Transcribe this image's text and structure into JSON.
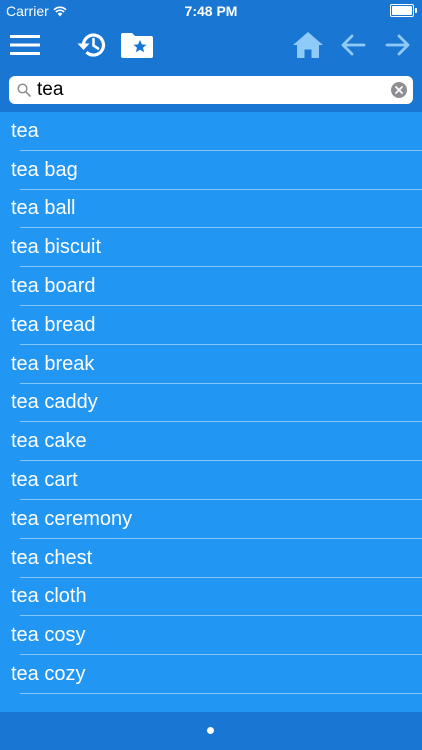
{
  "status_bar": {
    "carrier": "Carrier",
    "time": "7:48 PM"
  },
  "toolbar": {
    "icons": [
      "menu-icon",
      "history-icon",
      "favorites-folder-icon",
      "home-icon",
      "back-arrow-icon",
      "forward-arrow-icon"
    ]
  },
  "search": {
    "value": "tea"
  },
  "results": [
    "tea",
    "tea bag",
    "tea ball",
    "tea biscuit",
    "tea board",
    "tea bread",
    "tea break",
    "tea caddy",
    "tea cake",
    "tea cart",
    "tea ceremony",
    "tea chest",
    "tea cloth",
    "tea cosy",
    "tea cozy"
  ],
  "colors": {
    "bar": "#1976D2",
    "list_background": "#2196F3",
    "inactive_icon": "#90CAF9"
  }
}
